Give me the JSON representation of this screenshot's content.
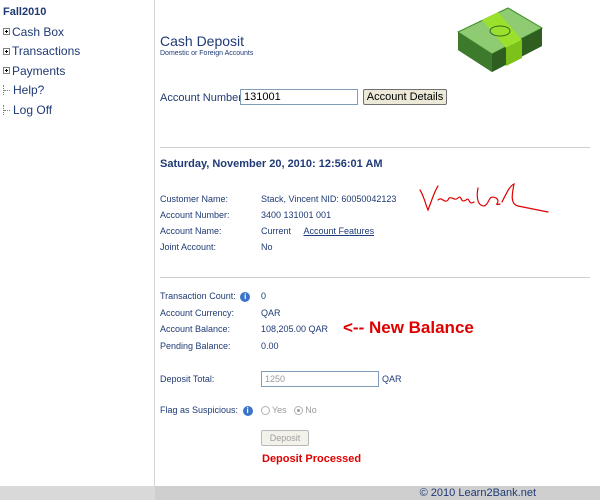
{
  "sidebar": {
    "root": "Fall2010",
    "items": [
      {
        "label": "Cash Box"
      },
      {
        "label": "Transactions"
      },
      {
        "label": "Payments"
      },
      {
        "label": "Help?"
      },
      {
        "label": "Log Off"
      }
    ]
  },
  "header": {
    "title": "Cash Deposit",
    "subtitle": "Domestic or Foreign Accounts"
  },
  "account_lookup": {
    "label": "Account Number:",
    "value": "131001",
    "button_label": "Account Details"
  },
  "datetime": "Saturday, November 20, 2010: 12:56:01 AM",
  "customer": {
    "name_label": "Customer Name:",
    "name_value": "Stack, Vincent NID: 60050042123",
    "account_number_label": "Account Number:",
    "account_number_value": "3400 131001 001",
    "account_name_label": "Account Name:",
    "account_name_value": "Current",
    "features_link": "Account Features",
    "joint_label": "Joint Account:",
    "joint_value": "No"
  },
  "balances": {
    "txn_count_label": "Transaction Count:",
    "txn_count_value": "0",
    "currency_label": "Account Currency:",
    "currency_value": "QAR",
    "balance_label": "Account Balance:",
    "balance_value": "108,205.00 QAR",
    "pending_label": "Pending Balance:",
    "pending_value": "0.00",
    "annotation": "<-- New Balance"
  },
  "deposit": {
    "total_label": "Deposit Total:",
    "total_value": "1250",
    "currency_suffix": "QAR",
    "suspicious_label": "Flag as Suspicious:",
    "option_yes": "Yes",
    "option_no": "No",
    "selected": "No",
    "button_label": "Deposit",
    "status": "Deposit Processed"
  },
  "footer": {
    "copyright": "© 2010 Learn2Bank.net"
  },
  "colors": {
    "text_blue": "#1f3a75",
    "alert_red": "#e00000",
    "money_green": "#3f8f2a",
    "band_green": "#9be02c"
  },
  "icons": [
    "expand-plus-icon",
    "tree-leaf-icon",
    "money-stack-icon",
    "info-icon",
    "signature-icon"
  ]
}
